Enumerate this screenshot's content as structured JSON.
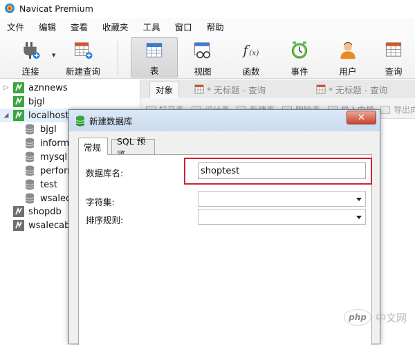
{
  "window": {
    "title": "Navicat Premium"
  },
  "menu": [
    "文件",
    "编辑",
    "查看",
    "收藏夹",
    "工具",
    "窗口",
    "帮助"
  ],
  "toolbar": [
    {
      "label": "连接",
      "icon": "plug-icon"
    },
    {
      "label": "新建查询",
      "icon": "new-query-icon"
    },
    {
      "label": "表",
      "icon": "table-icon",
      "active": true
    },
    {
      "label": "视图",
      "icon": "view-icon"
    },
    {
      "label": "函数",
      "icon": "function-icon"
    },
    {
      "label": "事件",
      "icon": "clock-icon"
    },
    {
      "label": "用户",
      "icon": "user-icon"
    },
    {
      "label": "查询",
      "icon": "query-icon"
    }
  ],
  "tree": {
    "connections": [
      {
        "label": "aznnews"
      },
      {
        "label": "bjgl"
      },
      {
        "label": "localhost_"
      },
      {
        "label": "shopdb"
      },
      {
        "label": "wsalecabi"
      }
    ],
    "databases": [
      "bjgl",
      "informa",
      "mysql",
      "perforn",
      "test",
      "wsaleca"
    ]
  },
  "tabs": {
    "objects": "对象",
    "query1": "* 无标题 - 查询",
    "query2": "* 无标题 - 查询"
  },
  "subbar": [
    "打开表",
    "设计表",
    "新建表",
    "删除表",
    "导入向导",
    "导出向"
  ],
  "dialog": {
    "title": "新建数据库",
    "close_symbol": "✕",
    "tabs": [
      "常规",
      "SQL 预览"
    ],
    "db_name_label": "数据库名:",
    "db_name_value": "shoptest",
    "charset_label": "字符集:",
    "charset_value": "",
    "collation_label": "排序规则:",
    "collation_value": ""
  },
  "watermark": {
    "badge": "php",
    "text": "中文网"
  },
  "colors": {
    "highlight": "#d0212f",
    "connection_green": "#3aa541",
    "dialog_close": "#c8462c"
  }
}
